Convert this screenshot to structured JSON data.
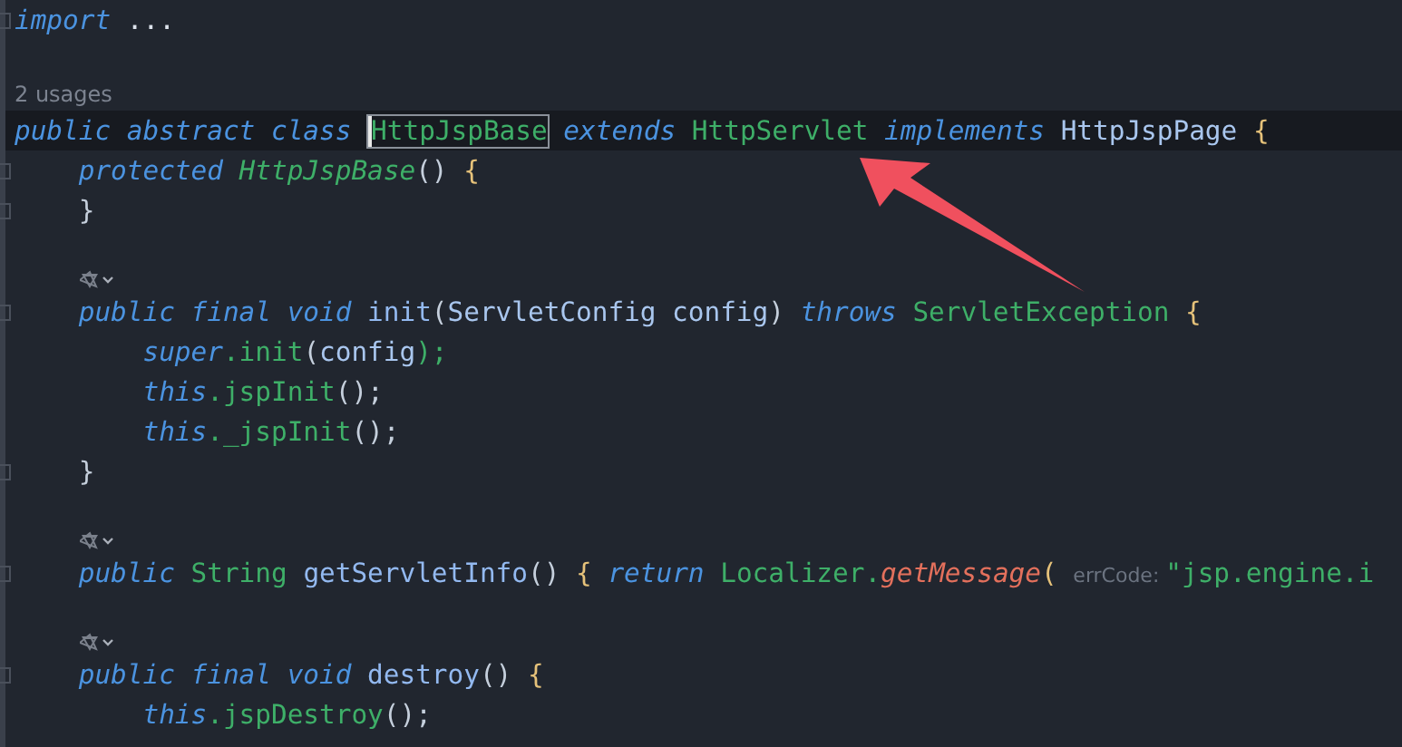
{
  "editor": {
    "lines": [
      {
        "kind": "code",
        "current": false,
        "fold": true,
        "tokens": [
          {
            "text": "import ",
            "kind": "keyword"
          },
          {
            "text": "...",
            "kind": "folded"
          }
        ]
      },
      {
        "kind": "blank"
      },
      {
        "kind": "hint",
        "text": "2 usages"
      },
      {
        "kind": "code",
        "current": true,
        "fold": false,
        "tokens": [
          {
            "text": "public abstract class ",
            "kind": "keyword"
          },
          {
            "text": "HttpJspBase",
            "kind": "class",
            "boxed": true
          },
          {
            "text": " extends ",
            "kind": "keyword"
          },
          {
            "text": "HttpServlet ",
            "kind": "class"
          },
          {
            "text": "implements ",
            "kind": "keyword"
          },
          {
            "text": "HttpJspPage ",
            "kind": "interface"
          },
          {
            "text": "{",
            "kind": "brace"
          }
        ]
      },
      {
        "kind": "code",
        "current": false,
        "fold": true,
        "tokens": [
          {
            "text": "    protected ",
            "kind": "keyword"
          },
          {
            "text": "HttpJspBase",
            "kind": "constructor"
          },
          {
            "text": "() ",
            "kind": "plain"
          },
          {
            "text": "{",
            "kind": "brace"
          }
        ]
      },
      {
        "kind": "code",
        "current": false,
        "fold": true,
        "tokens": [
          {
            "text": "    }",
            "kind": "plain"
          }
        ]
      },
      {
        "kind": "blank"
      },
      {
        "kind": "gutter-mark"
      },
      {
        "kind": "code",
        "current": false,
        "fold": true,
        "tokens": [
          {
            "text": "    public final void ",
            "kind": "keyword"
          },
          {
            "text": "init",
            "kind": "declaration"
          },
          {
            "text": "(",
            "kind": "plain"
          },
          {
            "text": "ServletConfig config",
            "kind": "interface"
          },
          {
            "text": ") ",
            "kind": "plain"
          },
          {
            "text": "throws ",
            "kind": "keyword"
          },
          {
            "text": "ServletException ",
            "kind": "class"
          },
          {
            "text": "{",
            "kind": "brace"
          }
        ]
      },
      {
        "kind": "code",
        "current": false,
        "fold": false,
        "tokens": [
          {
            "text": "        super",
            "kind": "keyword"
          },
          {
            "text": ".init",
            "kind": "call"
          },
          {
            "text": "(",
            "kind": "plain"
          },
          {
            "text": "config",
            "kind": "interface"
          },
          {
            "text": ");",
            "kind": "call"
          }
        ]
      },
      {
        "kind": "code",
        "current": false,
        "fold": false,
        "tokens": [
          {
            "text": "        this",
            "kind": "keyword"
          },
          {
            "text": ".jspInit",
            "kind": "call"
          },
          {
            "text": "();",
            "kind": "plain"
          }
        ]
      },
      {
        "kind": "code",
        "current": false,
        "fold": false,
        "tokens": [
          {
            "text": "        this",
            "kind": "keyword"
          },
          {
            "text": "._jspInit",
            "kind": "call"
          },
          {
            "text": "();",
            "kind": "plain"
          }
        ]
      },
      {
        "kind": "code",
        "current": false,
        "fold": true,
        "tokens": [
          {
            "text": "    }",
            "kind": "plain"
          }
        ]
      },
      {
        "kind": "blank"
      },
      {
        "kind": "gutter-mark"
      },
      {
        "kind": "code",
        "current": false,
        "fold": true,
        "tokens": [
          {
            "text": "    public ",
            "kind": "keyword"
          },
          {
            "text": "String ",
            "kind": "class"
          },
          {
            "text": "getServletInfo",
            "kind": "declaration"
          },
          {
            "text": "() ",
            "kind": "plain"
          },
          {
            "text": "{ ",
            "kind": "brace"
          },
          {
            "text": "return ",
            "kind": "keyword"
          },
          {
            "text": "Localizer.",
            "kind": "class"
          },
          {
            "text": "getMessage",
            "kind": "static-call"
          },
          {
            "text": "( ",
            "kind": "brace"
          },
          {
            "text": "errCode: ",
            "kind": "param-hint"
          },
          {
            "text": "\"jsp.engine.i",
            "kind": "string"
          }
        ]
      },
      {
        "kind": "blank"
      },
      {
        "kind": "gutter-mark"
      },
      {
        "kind": "code",
        "current": false,
        "fold": true,
        "tokens": [
          {
            "text": "    public final void ",
            "kind": "keyword"
          },
          {
            "text": "destroy",
            "kind": "declaration"
          },
          {
            "text": "() ",
            "kind": "plain"
          },
          {
            "text": "{",
            "kind": "brace"
          }
        ]
      },
      {
        "kind": "code",
        "current": false,
        "fold": false,
        "tokens": [
          {
            "text": "        this",
            "kind": "keyword"
          },
          {
            "text": ".jspDestroy",
            "kind": "call"
          },
          {
            "text": "();",
            "kind": "plain"
          }
        ]
      }
    ]
  },
  "annotation": {
    "kind": "arrow"
  }
}
